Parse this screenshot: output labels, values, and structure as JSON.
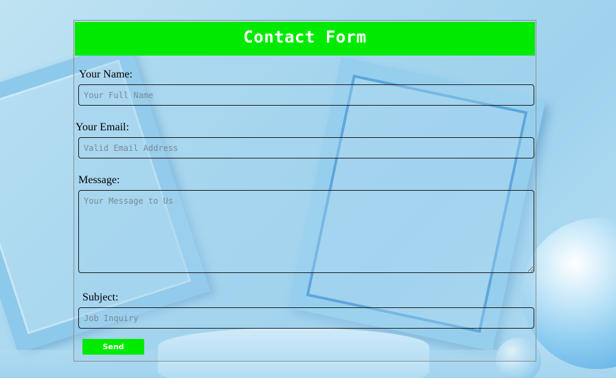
{
  "form": {
    "title": "Contact Form",
    "fields": {
      "name": {
        "label": "Your Name:",
        "placeholder": "Your Full Name",
        "value": ""
      },
      "email": {
        "label": "Your Email:",
        "placeholder": "Valid Email Address",
        "value": ""
      },
      "message": {
        "label": "Message:",
        "placeholder": "Your Message to Us",
        "value": ""
      },
      "subject": {
        "label": "Subject:",
        "placeholder": "Job Inquiry",
        "value": ""
      }
    },
    "submit_label": "Send"
  },
  "colors": {
    "header_bg": "#00ea00",
    "button_bg": "#00ea00",
    "title_text": "#ffffff",
    "card_border": "#8f8f8f"
  },
  "background": {
    "image": "blue-picture-frames-spheres-podium"
  }
}
